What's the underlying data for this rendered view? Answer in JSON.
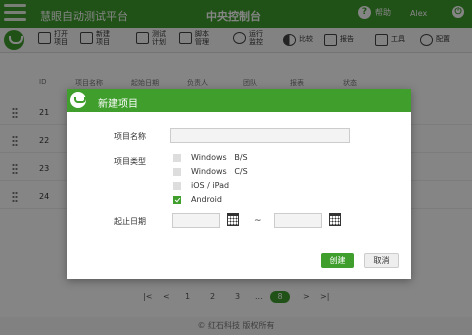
{
  "app": {
    "title": "慧眼自动测试平台",
    "center_title": "中央控制台",
    "help_label": "帮助",
    "user": "Alex",
    "power_icon": "power-icon"
  },
  "toolbar": [
    {
      "name": "open-project-button",
      "icon": "folder-open-icon",
      "label": "打开\n项目"
    },
    {
      "name": "new-project-button",
      "icon": "plus-square-icon",
      "label": "新建\n项目"
    },
    {
      "name": "test-plan-button",
      "icon": "clipboard-icon",
      "label": "测试\n计划"
    },
    {
      "name": "script-manage-button",
      "icon": "script-icon",
      "label": "脚本\n管理"
    },
    {
      "name": "run-monitor-button",
      "icon": "binoculars-icon",
      "label": "运行\n监控"
    },
    {
      "name": "compare-button",
      "icon": "compare-icon",
      "label": "比较"
    },
    {
      "name": "report-button",
      "icon": "report-icon",
      "label": "报告"
    },
    {
      "name": "tools-button",
      "icon": "tools-icon",
      "label": "工具"
    },
    {
      "name": "settings-button",
      "icon": "gear-icon",
      "label": "配置"
    }
  ],
  "table": {
    "headers": [
      "ID",
      "项目名称",
      "起始日期",
      "负责人",
      "团队",
      "报表",
      "状态"
    ],
    "rows": [
      "21",
      "22",
      "23",
      "24"
    ]
  },
  "pager": {
    "first": "|<",
    "prev": "<",
    "pages": [
      "1",
      "2",
      "3",
      "...",
      "8"
    ],
    "current": "8",
    "next": ">",
    "last": ">|"
  },
  "footer": "© 红石科技 版权所有",
  "modal": {
    "title": "新建项目",
    "name_label": "项目名称",
    "name_value": "",
    "type_label": "项目类型",
    "types": [
      {
        "label": "Windows   B/S",
        "checked": false
      },
      {
        "label": "Windows   C/S",
        "checked": false
      },
      {
        "label": "iOS / iPad",
        "checked": false
      },
      {
        "label": "Android",
        "checked": true
      }
    ],
    "date_label": "起止日期",
    "date_separator": "~",
    "create_label": "创建",
    "cancel_label": "取消"
  },
  "colors": {
    "brand": "#3f9e2c"
  }
}
